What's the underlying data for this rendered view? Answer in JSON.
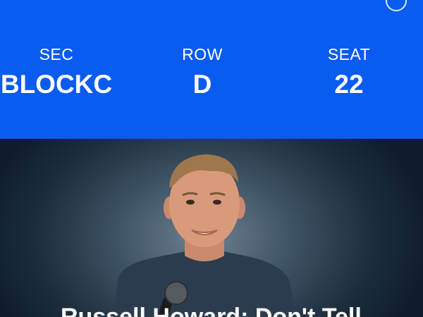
{
  "ticket": {
    "section": {
      "label": "SEC",
      "value": "BLOCKC"
    },
    "row": {
      "label": "ROW",
      "value": "D"
    },
    "seat": {
      "label": "SEAT",
      "value": "22"
    }
  },
  "event": {
    "title": "Russell Howard: Don't Tell"
  },
  "icons": {
    "info": "info-circle-icon"
  },
  "colors": {
    "header_background": "#0a5cf0",
    "text": "#ffffff"
  }
}
